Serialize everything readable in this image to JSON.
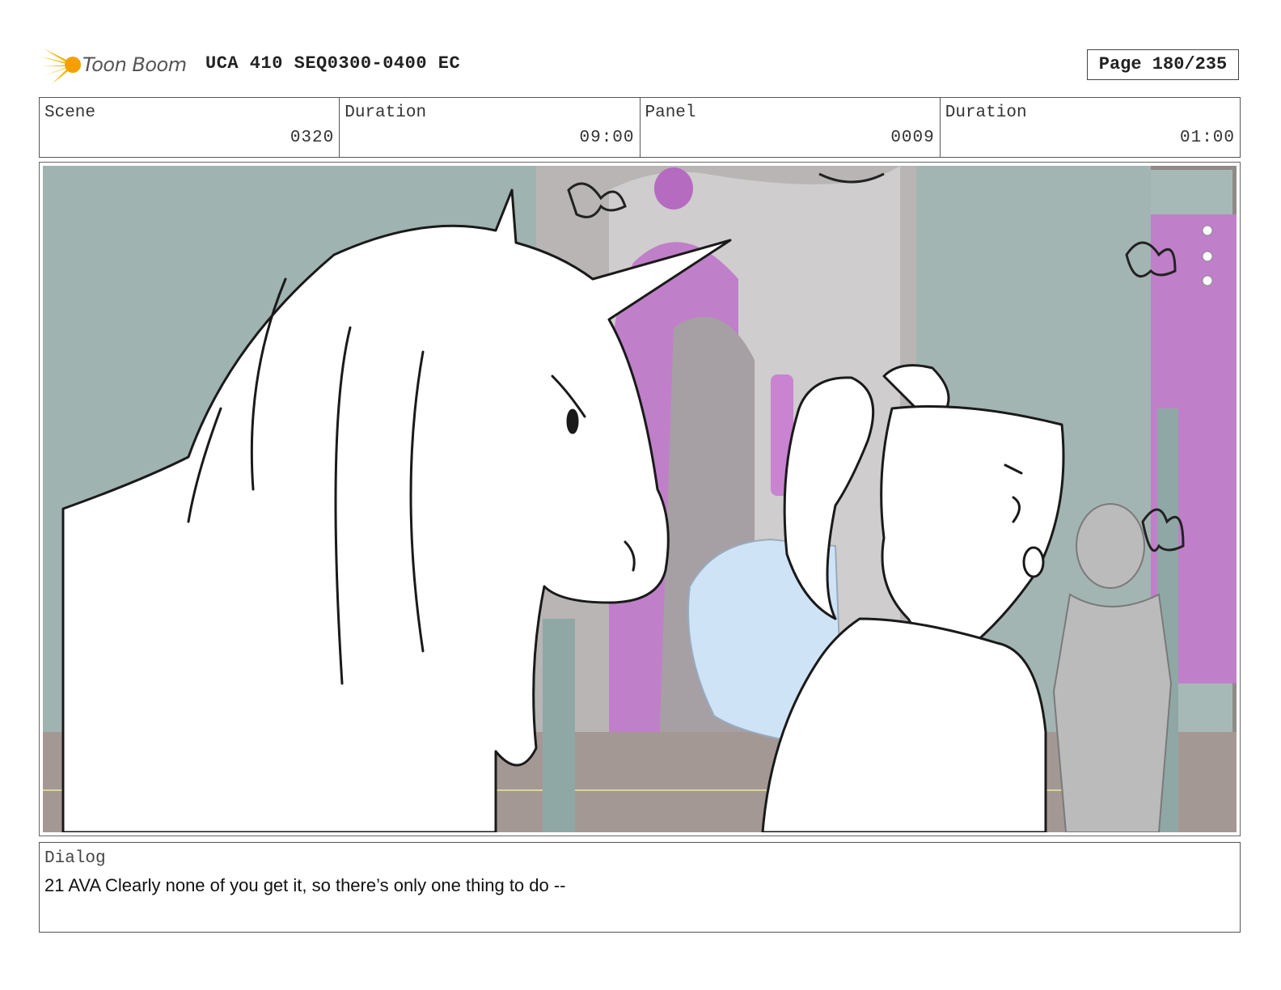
{
  "header": {
    "logo_text": "Toon Boom",
    "project_title": "UCA 410 SEQ0300-0400 EC",
    "page_label": "Page 180/235"
  },
  "info": {
    "scene_label": "Scene",
    "scene_value": "0320",
    "scene_duration_label": "Duration",
    "scene_duration_value": "09:00",
    "panel_label": "Panel",
    "panel_value": "0009",
    "panel_duration_label": "Duration",
    "panel_duration_value": "01:00"
  },
  "dialog": {
    "label": "Dialog",
    "text": "21 AVA Clearly none of you get it, so there’s only one thing to do --"
  },
  "colors": {
    "logo_yellow": "#f5b800",
    "bg_teal": "#9fb3b0",
    "bg_magenta": "#c07fc9",
    "bg_floor": "#a49894",
    "pillow_blue": "#cfe3f7"
  }
}
